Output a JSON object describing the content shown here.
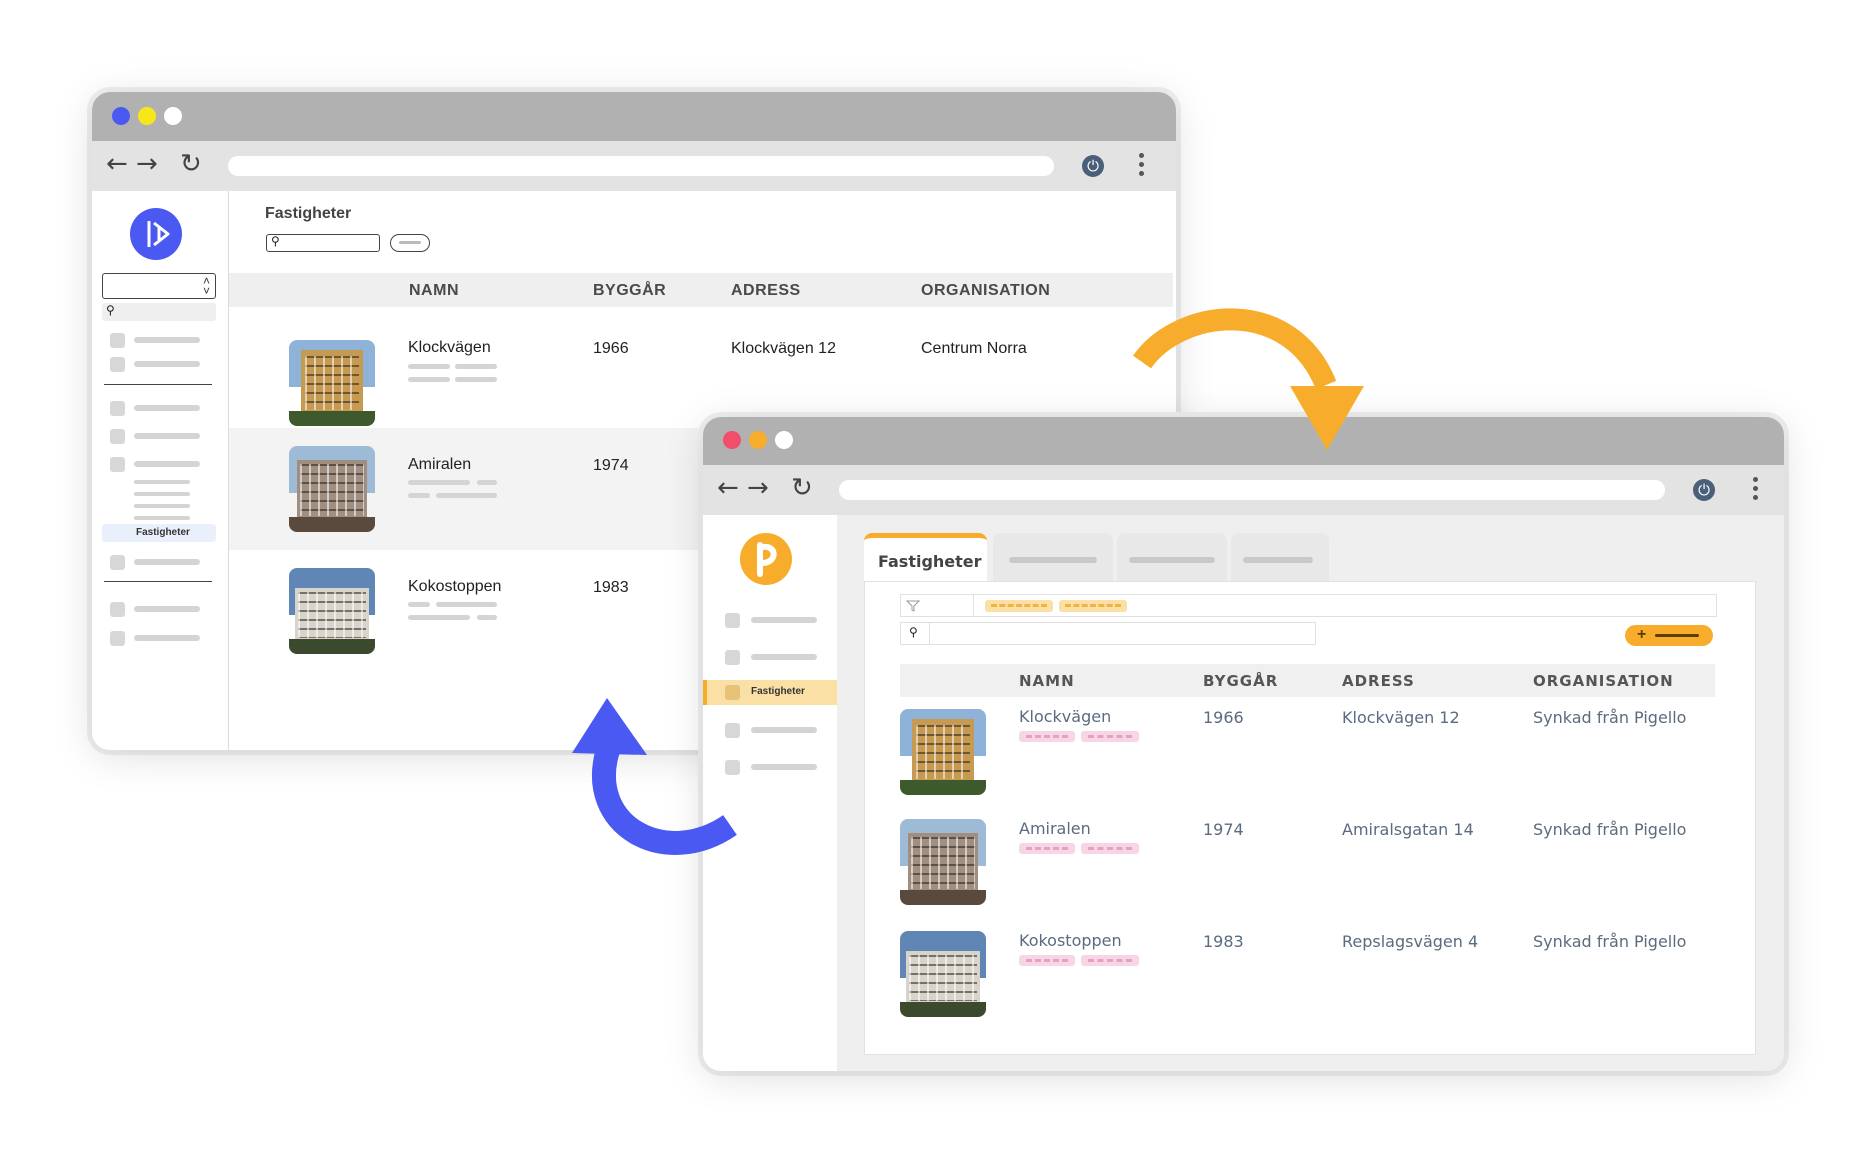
{
  "old_app": {
    "page_title": "Fastigheter",
    "sidebar_active_label": "Fastigheter",
    "columns": [
      "NAMN",
      "BYGGÅR",
      "ADRESS",
      "ORGANISATION"
    ],
    "rows": [
      {
        "name": "Klockvägen",
        "year": "1966",
        "address": "Klockvägen 12",
        "org": "Centrum Norra"
      },
      {
        "name": "Amiralen",
        "year": "1974"
      },
      {
        "name": "Kokostoppen",
        "year": "1983"
      }
    ],
    "dot_colors": [
      "#4a59f2",
      "#f7e71a",
      "#ffffff"
    ]
  },
  "new_app": {
    "active_tab": "Fastigheter",
    "sidebar_active_label": "Fastigheter",
    "add_button_label": "+",
    "columns": [
      "NAMN",
      "BYGGÅR",
      "ADRESS",
      "ORGANISATION"
    ],
    "rows": [
      {
        "name": "Klockvägen",
        "year": "1966",
        "address": "Klockvägen 12",
        "org": "Synkad från Pigello"
      },
      {
        "name": "Amiralen",
        "year": "1974",
        "address": "Amiralsgatan 14",
        "org": "Synkad från Pigello"
      },
      {
        "name": "Kokostoppen",
        "year": "1983",
        "address": "Repslagsvägen 4",
        "org": "Synkad från Pigello"
      }
    ],
    "dot_colors": [
      "#f24d6b",
      "#f7ad2b",
      "#ffffff"
    ]
  },
  "icons": {
    "back": "arrow-left-icon",
    "forward": "arrow-right-icon",
    "reload": "reload-icon",
    "power": "power-icon",
    "menu": "kebab-menu-icon",
    "search": "search-icon",
    "filter": "filter-icon"
  },
  "colors": {
    "old_accent": "#4a59f2",
    "new_accent": "#f7ad2b",
    "arrow_blue": "#4a59f2",
    "arrow_orange": "#f7ad2b"
  }
}
